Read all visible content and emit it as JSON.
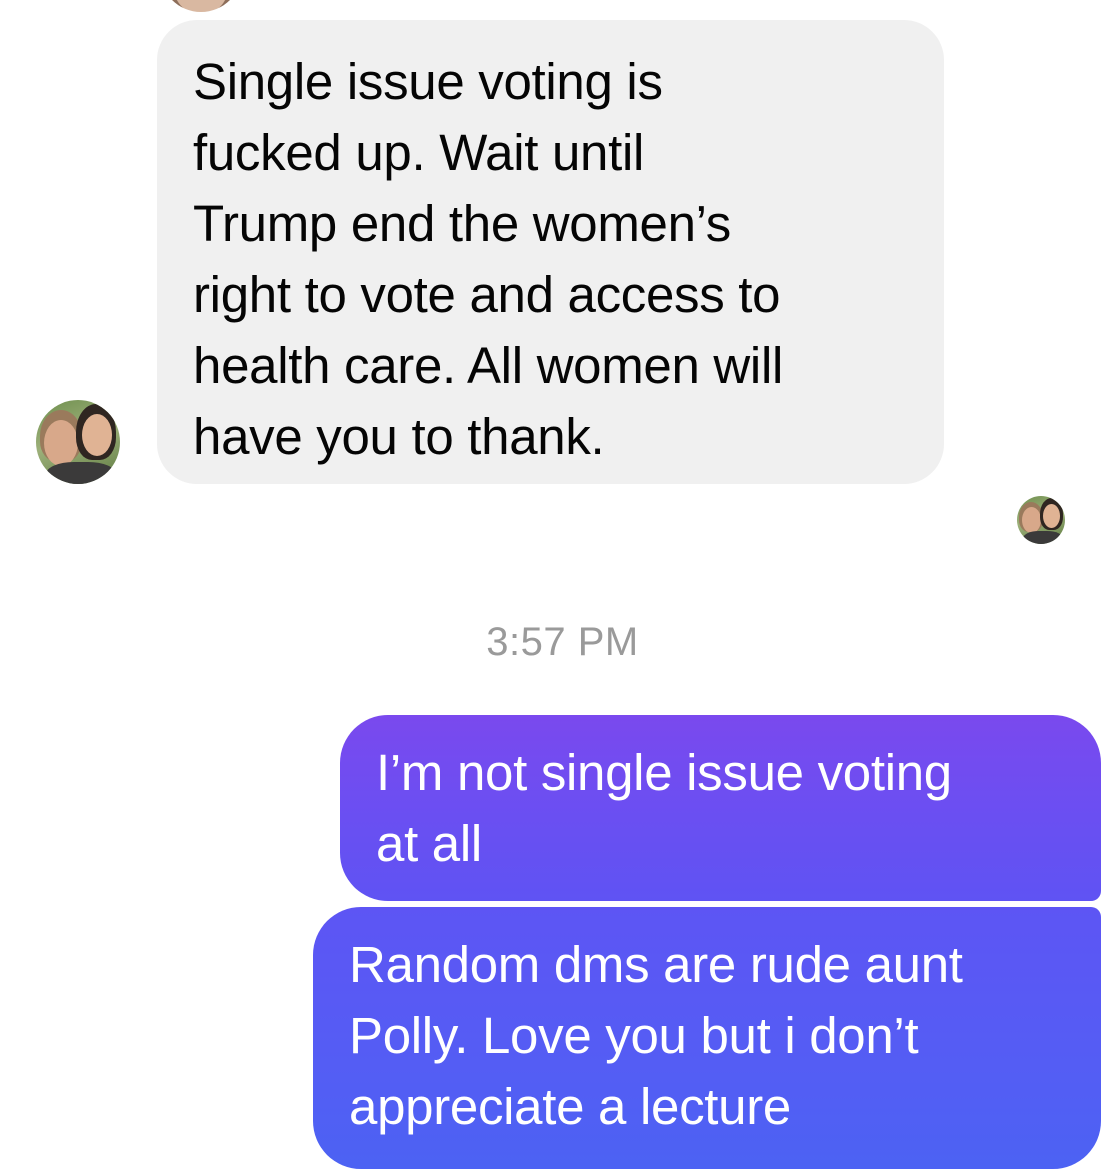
{
  "conversation": {
    "incoming_message": {
      "lines": [
        "Single issue voting is",
        "fucked up.  Wait until",
        "Trump end the women’s",
        "right to vote and access to",
        "health care.  All women will",
        "have you to thank."
      ],
      "bubble_color": "#f0f0f0",
      "text_color": "#050505"
    },
    "timestamp": "3:57 PM",
    "outgoing_messages": [
      {
        "lines": [
          "I’m not single issue voting",
          "at all"
        ],
        "bubble_color": "#6a4ff2",
        "text_color": "#ffffff"
      },
      {
        "lines": [
          "Random dms are rude aunt",
          "Polly. Love you but i don’t",
          "appreciate a lecture"
        ],
        "bubble_color": "#545df4",
        "text_color": "#ffffff"
      }
    ]
  }
}
